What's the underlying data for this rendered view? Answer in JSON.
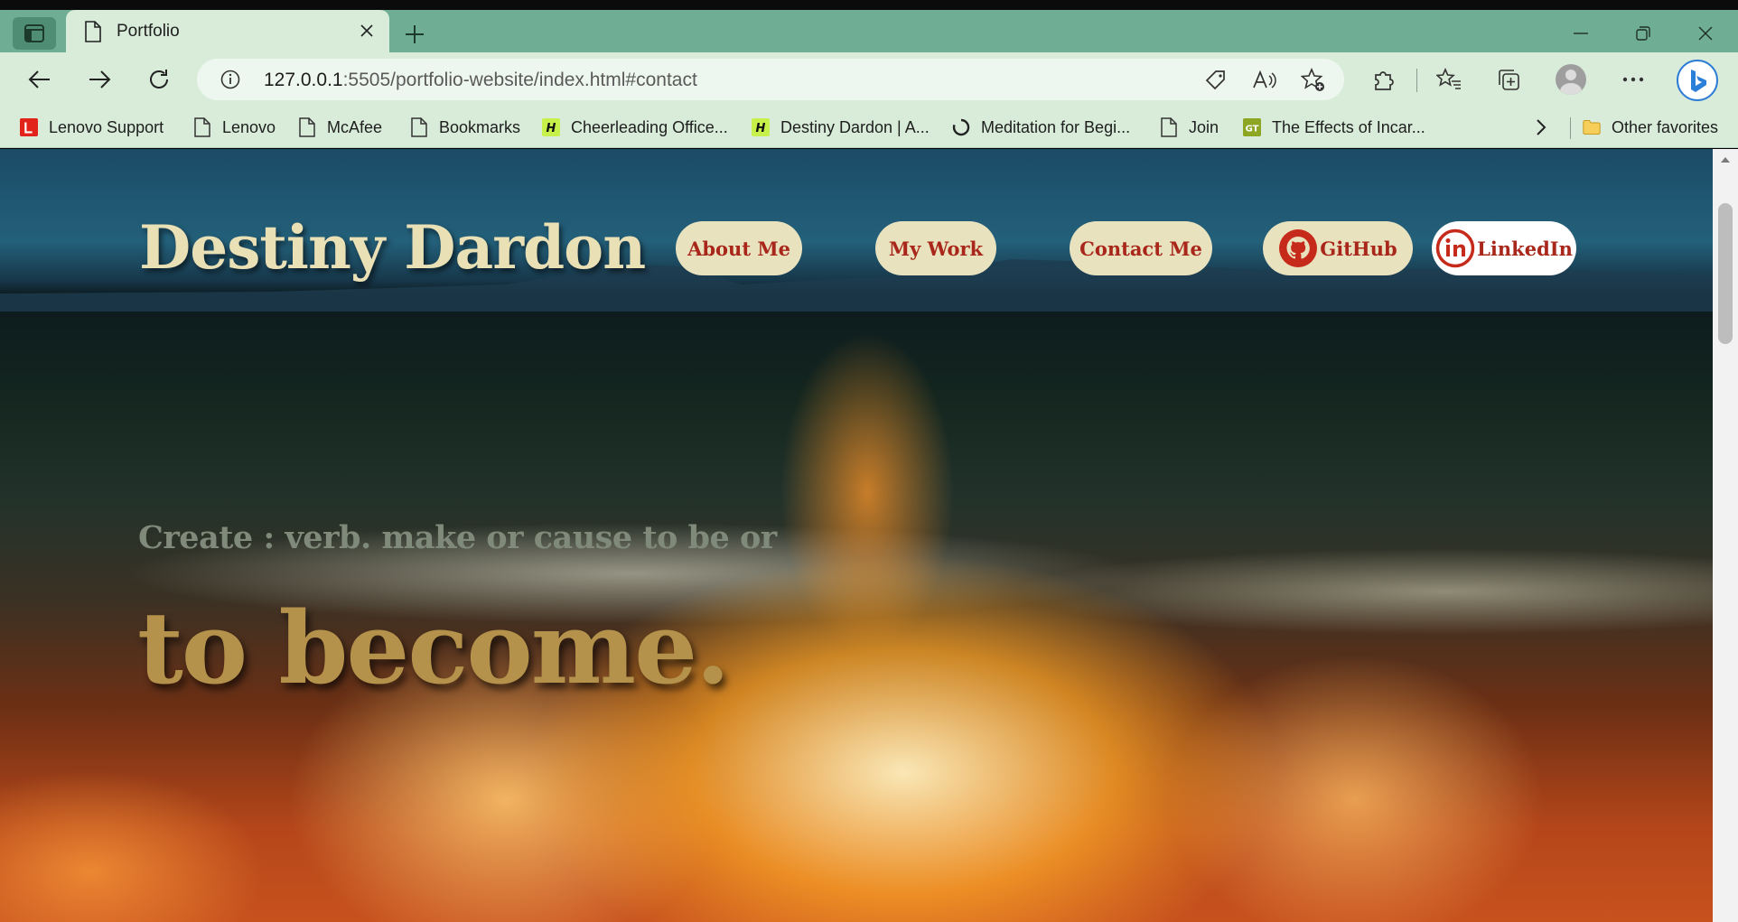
{
  "browser": {
    "tab": {
      "title": "Portfolio"
    },
    "url": {
      "host": "127.0.0.1",
      "rest": ":5505/portfolio-website/index.html#contact"
    },
    "bookmarks": [
      {
        "label": "Lenovo Support",
        "icon": "lenovo-red-icon"
      },
      {
        "label": "Lenovo",
        "icon": "page-icon"
      },
      {
        "label": "McAfee",
        "icon": "page-icon"
      },
      {
        "label": "Bookmarks",
        "icon": "page-icon"
      },
      {
        "label": "Cheerleading Office...",
        "icon": "h-icon"
      },
      {
        "label": "Destiny Dardon | A...",
        "icon": "h-icon"
      },
      {
        "label": "Meditation for Begi...",
        "icon": "circle-icon"
      },
      {
        "label": "Join",
        "icon": "page-icon"
      },
      {
        "label": "The Effects of Incar...",
        "icon": "gt-icon"
      }
    ],
    "other_favorites": "Other favorites"
  },
  "site": {
    "title": "Destiny Dardon",
    "nav": [
      {
        "label": "About Me"
      },
      {
        "label": "My Work"
      },
      {
        "label": "Contact Me"
      },
      {
        "label": "GitHub",
        "icon": "github-icon"
      },
      {
        "label": "LinkedIn",
        "icon": "linkedin-icon"
      }
    ],
    "tagline": "Create : verb. make or cause to be or",
    "big_word": "to become."
  },
  "colors": {
    "title": "#eae0b6",
    "pill_bg": "#e9e2bf",
    "pill_text": "#a8271a",
    "tagline": "#7f8a7a",
    "big_word": "#b5924b",
    "chrome_tabbar": "#6fae94",
    "chrome_toolbar": "#d8ecd9"
  }
}
